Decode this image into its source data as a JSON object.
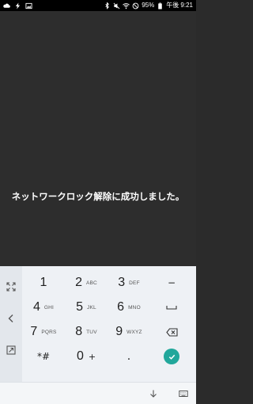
{
  "status_bar": {
    "battery": "95%",
    "time": "午後 9:21",
    "icons_left": [
      "cloud-icon",
      "flash-icon",
      "image-icon"
    ],
    "icons_right": [
      "bluetooth-icon",
      "mute-icon",
      "wifi-icon",
      "blocked-icon",
      "battery-icon"
    ]
  },
  "main": {
    "message": "ネットワークロック解除に成功しました。"
  },
  "keyboard": {
    "side": [
      "expand-icon",
      "back-arrow-icon",
      "resize-icon"
    ],
    "rows": [
      [
        {
          "num": "1",
          "sub": ""
        },
        {
          "num": "2",
          "sub": "ABC"
        },
        {
          "num": "3",
          "sub": "DEF"
        },
        {
          "sym": "−"
        }
      ],
      [
        {
          "num": "4",
          "sub": "GHI"
        },
        {
          "num": "5",
          "sub": "JKL"
        },
        {
          "num": "6",
          "sub": "MNO"
        },
        {
          "sym": "space"
        }
      ],
      [
        {
          "num": "7",
          "sub": "PQRS"
        },
        {
          "num": "8",
          "sub": "TUV"
        },
        {
          "num": "9",
          "sub": "WXYZ"
        },
        {
          "sym": "backspace"
        }
      ],
      [
        {
          "num": "*#",
          "sub": ""
        },
        {
          "num": "0",
          "sub": "+"
        },
        {
          "num": ".",
          "sub": ""
        },
        {
          "sym": "done"
        }
      ]
    ],
    "accent": "#21a79b"
  },
  "navbar": {
    "icons": [
      "hide-keyboard-icon",
      "keyboard-switch-icon"
    ]
  }
}
